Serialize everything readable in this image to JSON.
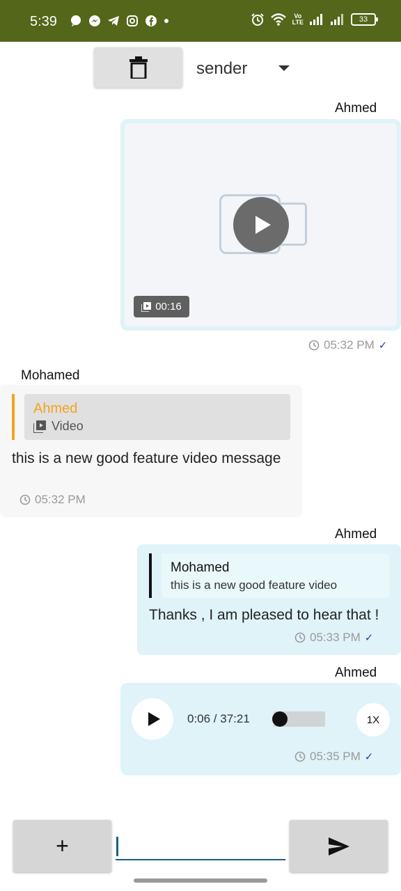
{
  "status_bar": {
    "time": "5:39",
    "battery": "33",
    "volte_top": "Vo",
    "volte_bottom": "LTE",
    "background": "#536619"
  },
  "toolbar": {
    "delete_icon": "trash-icon",
    "sender_value": "sender"
  },
  "messages": [
    {
      "author": "Ahmed",
      "type": "video",
      "duration": "00:16",
      "time": "05:32 PM",
      "status": "✓"
    },
    {
      "author": "Mohamed",
      "reply": {
        "author": "Ahmed",
        "snippet": "Video"
      },
      "text": "this is a new good feature video message",
      "time": "05:32 PM"
    },
    {
      "author": "Ahmed",
      "reply": {
        "author": "Mohamed",
        "snippet": "this is a new good feature video"
      },
      "text": "Thanks , I am pleased to hear that !",
      "time": "05:33 PM",
      "status": "✓"
    },
    {
      "author": "Ahmed",
      "type": "audio",
      "position": "0:06 / 37:21",
      "progress": 0.003,
      "speed": "1X",
      "time": "05:35 PM",
      "status": "✓"
    }
  ],
  "composer": {
    "attach_label": "+",
    "input_value": "",
    "send_icon": "send-icon"
  },
  "colors": {
    "accent_orange": "#f4a21e",
    "bubble_blue": "#dff3f8",
    "check_blue": "#2a3da6",
    "input_underline": "#1b5f86"
  }
}
